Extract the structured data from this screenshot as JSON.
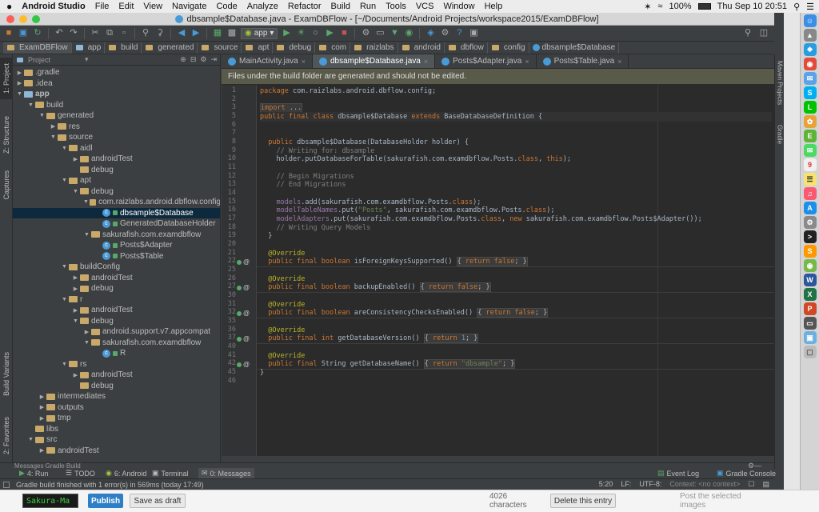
{
  "mac_menubar": {
    "app_name": "Android Studio",
    "menus": [
      "File",
      "Edit",
      "View",
      "Navigate",
      "Code",
      "Analyze",
      "Refactor",
      "Build",
      "Run",
      "Tools",
      "VCS",
      "Window",
      "Help"
    ],
    "battery": "100%",
    "clock": "Thu Sep 10  20:51"
  },
  "window": {
    "title": "dbsample$Database.java - ExamDBFlow - [~/Documents/Android Projects/workspace2015/ExamDBFlow]"
  },
  "toolbar": {
    "run_config": "app"
  },
  "breadcrumbs": [
    "ExamDBFlow",
    "app",
    "build",
    "generated",
    "source",
    "apt",
    "debug",
    "com",
    "raizlabs",
    "android",
    "dbflow",
    "config",
    "dbsample$Database"
  ],
  "left_strip": {
    "project": "1: Project",
    "structure": "Z: Structure",
    "captures": "Captures",
    "build_variants": "Build Variants",
    "favorites": "2: Favorites"
  },
  "right_strip": {
    "maven": "Maven Projects",
    "gradle": "Gradle"
  },
  "project_panel": {
    "view_selector": "Project",
    "tree": [
      {
        "label": ".gradle",
        "depth": 0,
        "expanded": false,
        "icon": "folder"
      },
      {
        "label": ".idea",
        "depth": 0,
        "expanded": false,
        "icon": "folder"
      },
      {
        "label": "app",
        "depth": 0,
        "expanded": true,
        "icon": "module-folder"
      },
      {
        "label": "build",
        "depth": 1,
        "expanded": true,
        "icon": "folder"
      },
      {
        "label": "generated",
        "depth": 2,
        "expanded": true,
        "icon": "folder"
      },
      {
        "label": "res",
        "depth": 3,
        "expanded": false,
        "icon": "folder"
      },
      {
        "label": "source",
        "depth": 3,
        "expanded": true,
        "icon": "folder"
      },
      {
        "label": "aidl",
        "depth": 4,
        "expanded": true,
        "icon": "folder"
      },
      {
        "label": "androidTest",
        "depth": 5,
        "expanded": false,
        "icon": "folder"
      },
      {
        "label": "debug",
        "depth": 5,
        "expanded": null,
        "icon": "folder"
      },
      {
        "label": "apt",
        "depth": 4,
        "expanded": true,
        "icon": "folder"
      },
      {
        "label": "debug",
        "depth": 5,
        "expanded": true,
        "icon": "folder"
      },
      {
        "label": "com.raizlabs.android.dbflow.config",
        "depth": 6,
        "expanded": true,
        "icon": "package"
      },
      {
        "label": "dbsample$Database",
        "depth": 7,
        "expanded": null,
        "icon": "class",
        "selected": true
      },
      {
        "label": "GeneratedDatabaseHolder",
        "depth": 7,
        "expanded": null,
        "icon": "class"
      },
      {
        "label": "sakurafish.com.examdbflow",
        "depth": 6,
        "expanded": true,
        "icon": "package"
      },
      {
        "label": "Posts$Adapter",
        "depth": 7,
        "expanded": null,
        "icon": "class"
      },
      {
        "label": "Posts$Table",
        "depth": 7,
        "expanded": null,
        "icon": "class"
      },
      {
        "label": "buildConfig",
        "depth": 4,
        "expanded": true,
        "icon": "folder"
      },
      {
        "label": "androidTest",
        "depth": 5,
        "expanded": false,
        "icon": "folder"
      },
      {
        "label": "debug",
        "depth": 5,
        "expanded": false,
        "icon": "folder"
      },
      {
        "label": "r",
        "depth": 4,
        "expanded": true,
        "icon": "folder"
      },
      {
        "label": "androidTest",
        "depth": 5,
        "expanded": false,
        "icon": "folder"
      },
      {
        "label": "debug",
        "depth": 5,
        "expanded": true,
        "icon": "folder"
      },
      {
        "label": "android.support.v7.appcompat",
        "depth": 6,
        "expanded": false,
        "icon": "package"
      },
      {
        "label": "sakurafish.com.examdbflow",
        "depth": 6,
        "expanded": true,
        "icon": "package"
      },
      {
        "label": "R",
        "depth": 7,
        "expanded": null,
        "icon": "class"
      },
      {
        "label": "rs",
        "depth": 4,
        "expanded": true,
        "icon": "folder"
      },
      {
        "label": "androidTest",
        "depth": 5,
        "expanded": false,
        "icon": "folder"
      },
      {
        "label": "debug",
        "depth": 5,
        "expanded": null,
        "icon": "folder"
      },
      {
        "label": "intermediates",
        "depth": 2,
        "expanded": false,
        "icon": "folder"
      },
      {
        "label": "outputs",
        "depth": 2,
        "expanded": false,
        "icon": "folder"
      },
      {
        "label": "tmp",
        "depth": 2,
        "expanded": false,
        "icon": "folder"
      },
      {
        "label": "libs",
        "depth": 1,
        "expanded": null,
        "icon": "folder"
      },
      {
        "label": "src",
        "depth": 1,
        "expanded": true,
        "icon": "folder"
      },
      {
        "label": "androidTest",
        "depth": 2,
        "expanded": false,
        "icon": "folder"
      }
    ]
  },
  "editor_tabs": [
    {
      "label": "MainActivity.java",
      "active": false
    },
    {
      "label": "dbsample$Database.java",
      "active": true
    },
    {
      "label": "Posts$Adapter.java",
      "active": false
    },
    {
      "label": "Posts$Table.java",
      "active": false
    }
  ],
  "banner": "Files under the build folder are generated and should not be edited.",
  "code_lines": [
    {
      "n": "1",
      "html": "<span class=\"k\">package</span> com.raizlabs.android.dbflow.config;"
    },
    {
      "n": "2",
      "html": ""
    },
    {
      "n": "3",
      "html": "<span class=\"fd\"><span class=\"k\">import</span> ...</span>"
    },
    {
      "n": "5",
      "html": "<span class=\"k\">public final class</span> dbsample$Database <span class=\"k\">extends</span> BaseDatabaseDefinition {",
      "cur": true
    },
    {
      "n": "6",
      "html": ""
    },
    {
      "n": "7",
      "html": ""
    },
    {
      "n": "8",
      "html": "  <span class=\"k\">public</span> dbsample$Database(DatabaseHolder holder) {"
    },
    {
      "n": "9",
      "html": "    <span class=\"cm\">// Writing for: dbsample</span>"
    },
    {
      "n": "10",
      "html": "    holder.putDatabaseForTable(sakurafish.com.examdbflow.Posts.<span class=\"k\">class</span>, <span class=\"k\">this</span>);"
    },
    {
      "n": "11",
      "html": ""
    },
    {
      "n": "12",
      "html": "    <span class=\"cm\">// Begin Migrations</span>"
    },
    {
      "n": "13",
      "html": "    <span class=\"cm\">// End Migrations</span>"
    },
    {
      "n": "14",
      "html": ""
    },
    {
      "n": "15",
      "html": "    <span class=\"pu\">models</span>.add(sakurafish.com.examdbflow.Posts.<span class=\"k\">class</span>);"
    },
    {
      "n": "16",
      "html": "    <span class=\"pu\">modelTableNames</span>.put(<span class=\"s\">\"Posts\"</span>, sakurafish.com.examdbflow.Posts.<span class=\"k\">class</span>);"
    },
    {
      "n": "17",
      "html": "    <span class=\"pu\">modelAdapters</span>.put(sakurafish.com.examdbflow.Posts.<span class=\"k\">class</span>, <span class=\"k\">new</span> sakurafish.com.examdbflow.Posts$Adapter());"
    },
    {
      "n": "18",
      "html": "    <span class=\"cm\">// Writing Query Models</span>"
    },
    {
      "n": "19",
      "html": "  }"
    },
    {
      "n": "20",
      "html": ""
    },
    {
      "n": "21",
      "html": "  <span class=\"an\">@Override</span>"
    },
    {
      "n": "22",
      "html": "  <span class=\"k\">public final boolean</span> isForeignKeysSupported() <span class=\"fd\">{ <span class=\"k\">return false</span>; }</span>",
      "gicon": true
    },
    {
      "n": "25",
      "html": ""
    },
    {
      "n": "26",
      "html": "  <span class=\"an\">@Override</span>"
    },
    {
      "n": "27",
      "html": "  <span class=\"k\">public final boolean</span> backupEnabled() <span class=\"fd\">{ <span class=\"k\">return false</span>; }</span>",
      "gicon": true
    },
    {
      "n": "30",
      "html": ""
    },
    {
      "n": "31",
      "html": "  <span class=\"an\">@Override</span>"
    },
    {
      "n": "32",
      "html": "  <span class=\"k\">public final boolean</span> areConsistencyChecksEnabled() <span class=\"fd\">{ <span class=\"k\">return false</span>; }</span>",
      "gicon": true
    },
    {
      "n": "35",
      "html": ""
    },
    {
      "n": "36",
      "html": "  <span class=\"an\">@Override</span>"
    },
    {
      "n": "37",
      "html": "  <span class=\"k\">public final int</span> getDatabaseVersion() <span class=\"fd\">{ <span class=\"k\">return</span> <span style=\"color:#6897bb\">1</span>; }</span>",
      "gicon": true
    },
    {
      "n": "40",
      "html": ""
    },
    {
      "n": "41",
      "html": "  <span class=\"an\">@Override</span>"
    },
    {
      "n": "42",
      "html": "  <span class=\"k\">public final</span> String getDatabaseName() <span class=\"fd\">{ <span class=\"k\">return</span> <span class=\"s\">\"dbsample\"</span>; }</span>",
      "gicon": true
    },
    {
      "n": "45",
      "html": "}"
    },
    {
      "n": "46",
      "html": ""
    }
  ],
  "bottom_panel": {
    "header": "Messages Gradle Build",
    "tabs": [
      {
        "label": "4: Run",
        "icon": "run-icon"
      },
      {
        "label": "TODO",
        "icon": "todo-icon"
      },
      {
        "label": "6: Android",
        "icon": "android-icon"
      },
      {
        "label": "Terminal",
        "icon": "terminal-icon"
      },
      {
        "label": "0: Messages",
        "icon": "messages-icon",
        "active": true
      }
    ],
    "right_tabs": [
      {
        "label": "Event Log"
      },
      {
        "label": "Gradle Console"
      }
    ]
  },
  "status": {
    "message": "Gradle build finished with 1 error(s) in 569ms (today 17:49)",
    "position": "5:20",
    "line_sep": "LF:",
    "encoding": "UTF-8:",
    "context": "Context: <no context>"
  },
  "background_page": {
    "terminal_text": "Sakura-Ma",
    "publish": "Publish",
    "save_draft": "Save as draft",
    "characters": "4026 characters",
    "delete_entry": "Delete this entry",
    "post_images": "Post the selected images"
  },
  "colors": {
    "accent_blue": "#4a9ad6",
    "run_green": "#59a869",
    "keyword": "#cc7832"
  }
}
